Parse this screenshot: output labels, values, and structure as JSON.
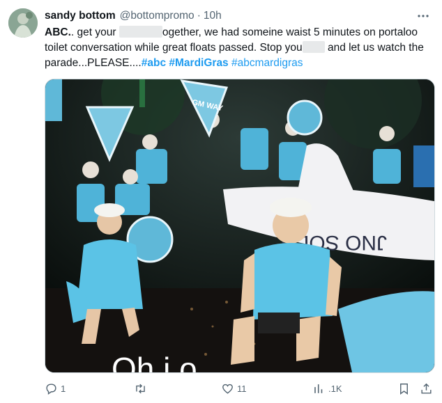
{
  "tweet": {
    "author_name": "sandy bottom",
    "author_handle": "@bottompromo",
    "separator": "·",
    "time": "10h",
    "text": {
      "part1": "ABC.",
      "part2": ". get your ",
      "part3": "ogether, we had someine waist 5 minutes on portaloo toilet conversation while great floats passed. Stop you",
      "part4": " and let us watch the parade...PLEASE....",
      "hashtags": [
        "#abc",
        "#MardiGras",
        "#abcmardigras"
      ]
    },
    "media": {
      "sign_text": "GM WAY",
      "banner_text": "JNO SOLO",
      "caption": "Oh i o"
    }
  },
  "actions": {
    "reply_count": "1",
    "repost_count": "",
    "like_count": "11",
    "views_count": ".1K"
  },
  "colors": {
    "link": "#1d9bf0",
    "muted": "#536471",
    "vest": "#5bc3e6"
  },
  "icons": [
    "more-icon",
    "reply-icon",
    "repost-icon",
    "like-icon",
    "views-icon",
    "bookmark-icon",
    "share-icon"
  ]
}
